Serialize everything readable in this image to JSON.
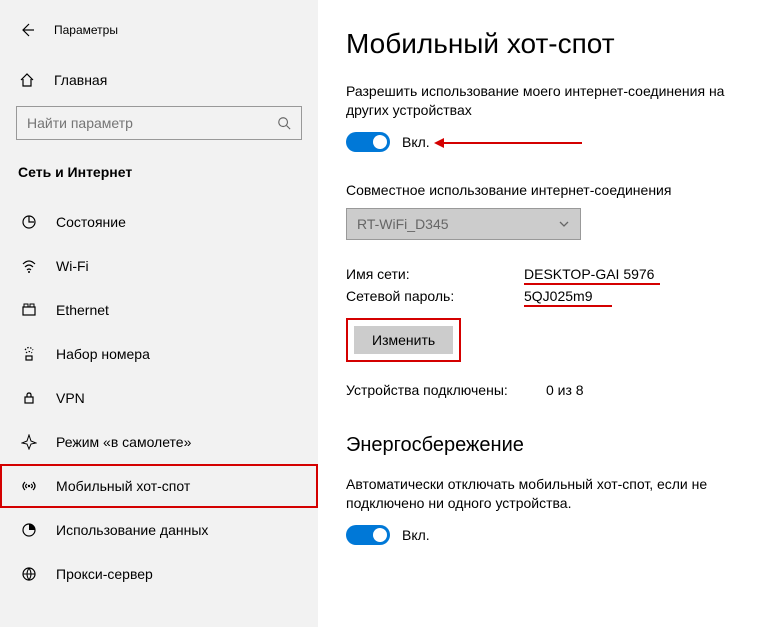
{
  "topbar": {
    "title": "Параметры"
  },
  "home": {
    "label": "Главная"
  },
  "search": {
    "placeholder": "Найти параметр"
  },
  "category": {
    "label": "Сеть и Интернет"
  },
  "nav": [
    {
      "label": "Состояние"
    },
    {
      "label": "Wi-Fi"
    },
    {
      "label": "Ethernet"
    },
    {
      "label": "Набор номера"
    },
    {
      "label": "VPN"
    },
    {
      "label": "Режим «в самолете»"
    },
    {
      "label": "Мобильный хот-спот"
    },
    {
      "label": "Использование данных"
    },
    {
      "label": "Прокси-сервер"
    }
  ],
  "page": {
    "title": "Мобильный хот-спот",
    "share_desc": "Разрешить использование моего интернет-соединения на других устройствах",
    "toggle1_label": "Вкл.",
    "connection_share_label": "Совместное использование интернет-соединения",
    "dropdown_value": "RT-WiFi_D345",
    "network_name_label": "Имя сети:",
    "network_name_value": "DESKTOP-GAI 5976",
    "network_pass_label": "Сетевой пароль:",
    "network_pass_value": "5QJ025m9",
    "change_btn": "Изменить",
    "devices_label": "Устройства подключены:",
    "devices_value": "0 из 8",
    "powersave_title": "Энергосбережение",
    "powersave_desc": "Автоматически отключать мобильный хот-спот, если не подключено ни одного устройства.",
    "toggle2_label": "Вкл."
  }
}
